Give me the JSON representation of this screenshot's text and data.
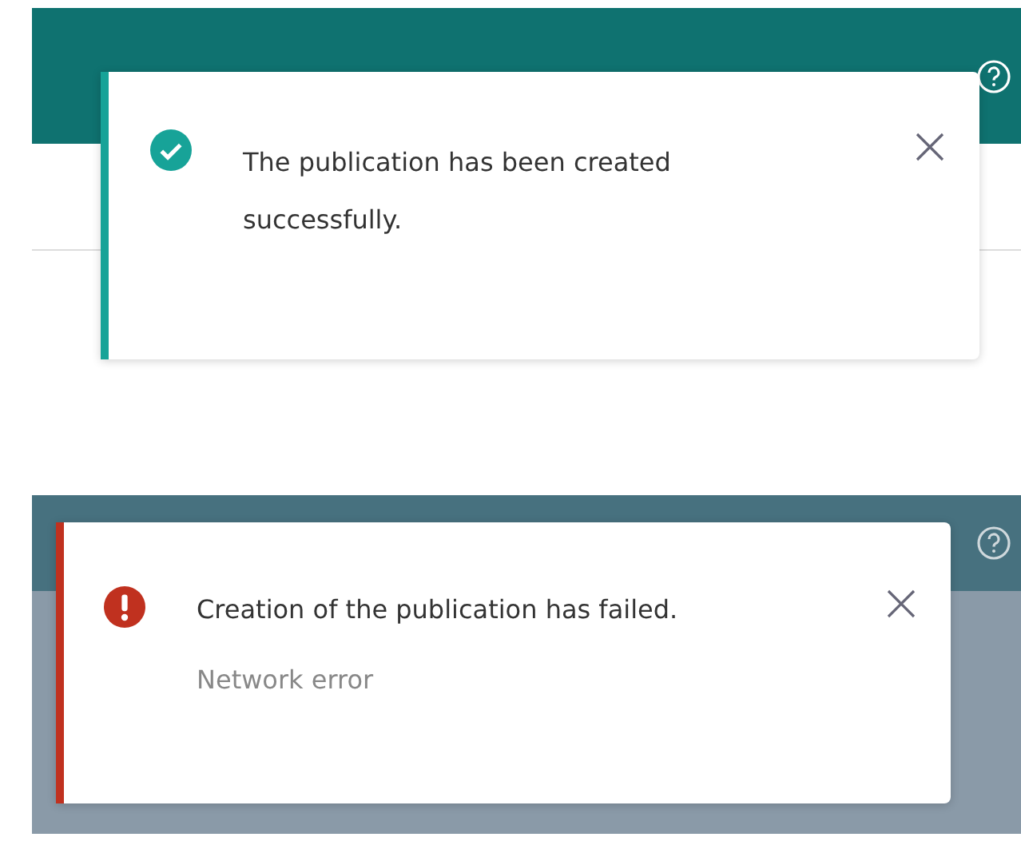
{
  "screens": [
    {
      "dimmed": false,
      "toast": {
        "kind": "success",
        "message": "The publication has been created successfully."
      }
    },
    {
      "dimmed": true,
      "toast": {
        "kind": "error",
        "message": "Creation of the publication has failed.",
        "detail": "Network error"
      }
    }
  ]
}
